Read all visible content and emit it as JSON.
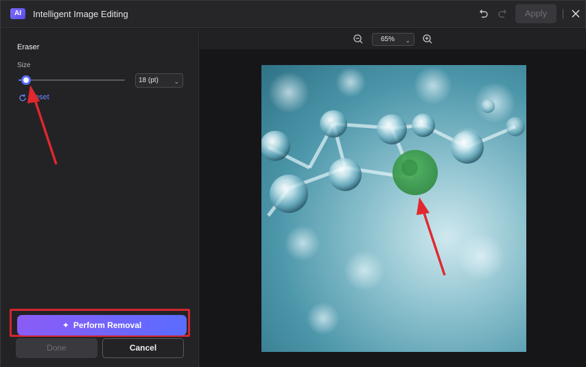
{
  "window": {
    "logo_text": "AI",
    "title": "Intelligent Image Editing",
    "apply_label": "Apply"
  },
  "icons": {
    "undo": "undo-icon",
    "redo": "redo-icon",
    "close": "close-icon",
    "zoom_out": "zoom-out-icon",
    "zoom_in": "zoom-in-icon",
    "reset": "reset-icon",
    "sparkle": "sparkle-icon"
  },
  "panel": {
    "section_title": "Eraser",
    "size_label": "Size",
    "size_value": "18 (pt)",
    "size_level": 0.08,
    "reset_label": "Reset",
    "perform_label": "Perform Removal",
    "done_label": "Done",
    "cancel_label": "Cancel"
  },
  "zoom": {
    "value": "65%"
  },
  "colors": {
    "accent": "#5b6cff",
    "highlight_box": "#d4262e",
    "annotation_arrow": "#e0282e",
    "eraser_mask": "#3fa34d"
  }
}
